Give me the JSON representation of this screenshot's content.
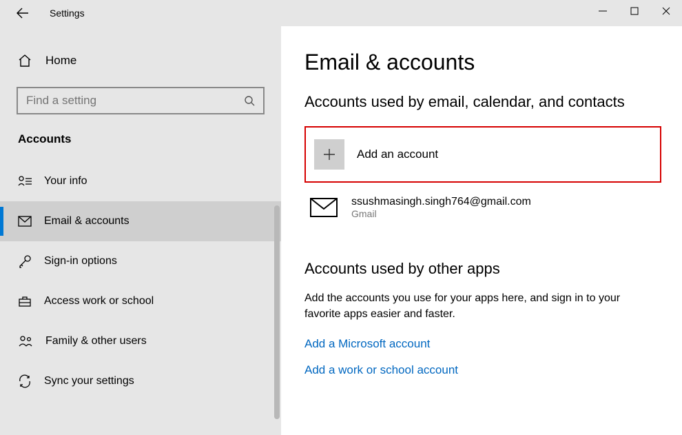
{
  "titlebar": {
    "title": "Settings"
  },
  "sidebar": {
    "home_label": "Home",
    "search_placeholder": "Find a setting",
    "section_header": "Accounts",
    "items": [
      {
        "label": "Your info"
      },
      {
        "label": "Email & accounts"
      },
      {
        "label": "Sign-in options"
      },
      {
        "label": "Access work or school"
      },
      {
        "label": "Family & other users"
      },
      {
        "label": "Sync your settings"
      }
    ]
  },
  "content": {
    "page_title": "Email & accounts",
    "section1_title": "Accounts used by email, calendar, and contacts",
    "add_account_label": "Add an account",
    "accounts": [
      {
        "email": "ssushmasingh.singh764@gmail.com",
        "provider": "Gmail"
      }
    ],
    "section2_title": "Accounts used by other apps",
    "section2_desc": "Add the accounts you use for your apps here, and sign in to your favorite apps easier and faster.",
    "link_ms": "Add a Microsoft account",
    "link_work": "Add a work or school account"
  }
}
